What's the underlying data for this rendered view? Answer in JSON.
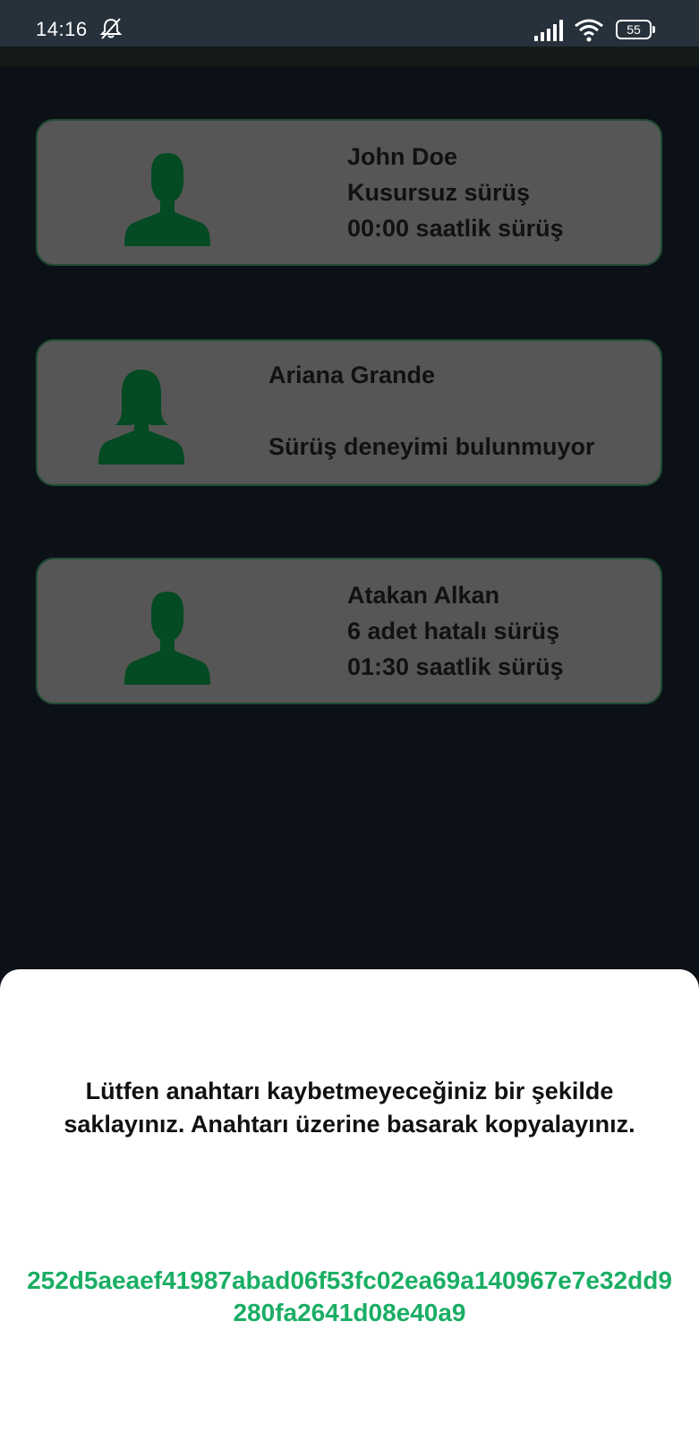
{
  "status_bar": {
    "time": "14:16",
    "battery": "55",
    "icons": [
      "mute-icon",
      "signal-icon",
      "wifi-icon",
      "battery-icon"
    ]
  },
  "drivers": [
    {
      "name": "John Doe",
      "status": "Kusursuz sürüş",
      "hours": "00:00 saatlik sürüş",
      "avatar": "male-user-icon"
    },
    {
      "name": "Ariana Grande",
      "status": "",
      "hours": "Sürüş deneyimi bulunmuyor",
      "avatar": "female-user-icon"
    },
    {
      "name": "Atakan Alkan",
      "status": "6 adet hatalı sürüş",
      "hours": "01:30 saatlik sürüş",
      "avatar": "male-user-icon"
    }
  ],
  "sheet": {
    "message": "Lütfen anahtarı kaybetmeyeceğiniz bir şekilde saklayınız. Anahtarı üzerine basarak kopyalayınız.",
    "key": "252d5aeaef41987abad06f53fc02ea69a140967e7e32dd9280fa2641d08e40a9"
  },
  "colors": {
    "background": "#0c1117",
    "status_bar": "#27313b",
    "card": "#565656",
    "card_border": "#1f4e33",
    "avatar": "#044a22",
    "key_text": "#1aae64"
  }
}
